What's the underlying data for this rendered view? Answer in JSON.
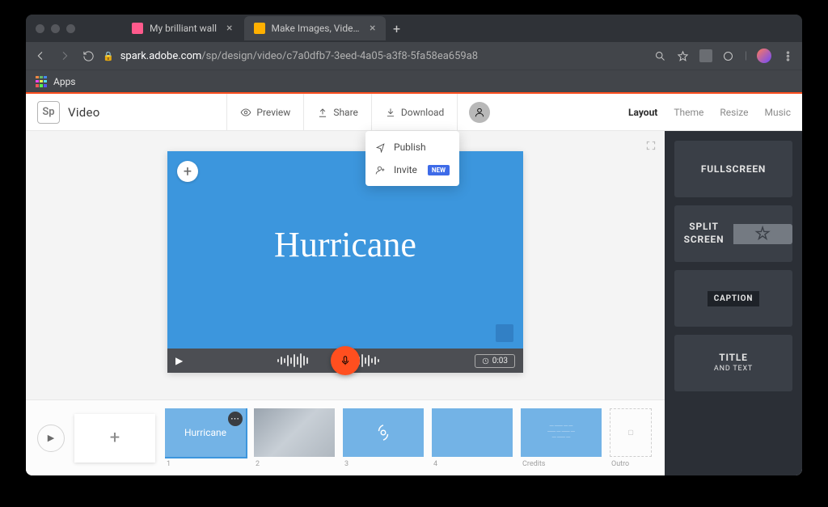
{
  "browser": {
    "tabs": [
      {
        "title": "My brilliant wall"
      },
      {
        "title": "Make Images, Videos and Web…"
      }
    ],
    "url_host": "spark.adobe.com",
    "url_path": "/sp/design/video/c7a0dfb7-3eed-4a05-a3f8-5fa58ea659a8",
    "bookmark_apps": "Apps"
  },
  "header": {
    "logo_badge": "Sp",
    "logo_text": "Video",
    "preview": "Preview",
    "share": "Share",
    "download": "Download",
    "nav": {
      "layout": "Layout",
      "theme": "Theme",
      "resize": "Resize",
      "music": "Music"
    }
  },
  "dropdown": {
    "publish": "Publish",
    "invite": "Invite",
    "new_badge": "NEW"
  },
  "slide": {
    "title": "Hurricane",
    "timer": "0:03"
  },
  "timeline": {
    "add": "+",
    "items": [
      {
        "label": "1",
        "text": "Hurricane",
        "selected": true,
        "type": "title"
      },
      {
        "label": "2",
        "type": "clouds"
      },
      {
        "label": "3",
        "type": "icon"
      },
      {
        "label": "4",
        "type": "blank"
      },
      {
        "label": "Credits",
        "type": "credits"
      }
    ],
    "outro": "Outro"
  },
  "layouts": {
    "fullscreen": "FULLSCREEN",
    "split_a": "SPLIT",
    "split_b": "SCREEN",
    "caption": "CAPTION",
    "title": "TITLE",
    "title_sub": "AND TEXT"
  }
}
